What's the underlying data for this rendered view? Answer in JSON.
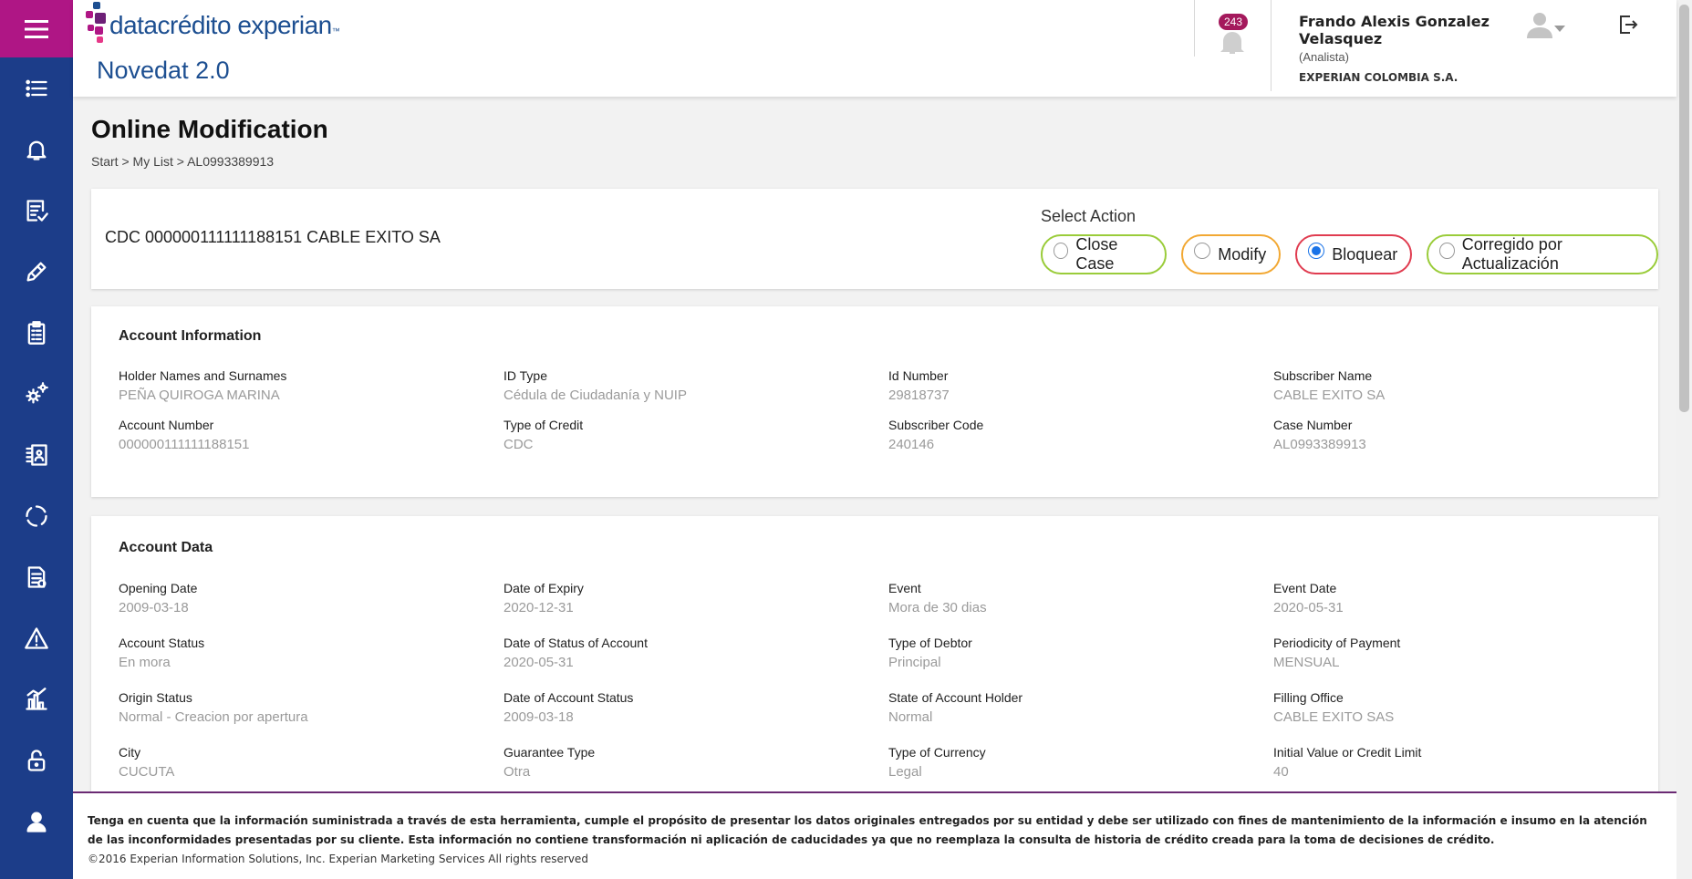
{
  "header": {
    "logo_text_a": "datacrédito",
    "logo_text_b": "experian",
    "logo_tm": "™",
    "app_name": "Novedat 2.0",
    "notification_count": "243",
    "user": {
      "name": "Frando Alexis Gonzalez Velasquez",
      "role": "(Analista)",
      "company": "EXPERIAN COLOMBIA S.A."
    }
  },
  "sidebar": {
    "items": [
      "list-icon",
      "bell-icon",
      "checklist-icon",
      "pencil-icon",
      "clipboard-icon",
      "gears-icon",
      "contacts-icon",
      "refresh-icon",
      "document-icon",
      "warning-icon",
      "chart-icon",
      "unlock-icon",
      "user-icon"
    ]
  },
  "page": {
    "title": "Online Modification",
    "breadcrumb": [
      "Start",
      ">",
      "My List",
      ">",
      "AL0993389913"
    ]
  },
  "case": {
    "id_text": "CDC 000000111111188151 CABLE EXITO SA",
    "select_action_label": "Select Action",
    "actions": [
      {
        "label": "Close Case",
        "selected": false,
        "color": "#9acc3a"
      },
      {
        "label": "Modify",
        "selected": false,
        "color": "#f2a833"
      },
      {
        "label": "Bloquear",
        "selected": true,
        "color": "#e03c50"
      },
      {
        "label": "Corregido por Actualización",
        "selected": false,
        "color": "#9acc3a"
      }
    ]
  },
  "account_information": {
    "title": "Account Information",
    "fields": [
      {
        "label": "Holder Names and Surnames",
        "value": "PEÑA QUIROGA MARINA"
      },
      {
        "label": "ID Type",
        "value": "Cédula de Ciudadanía y NUIP"
      },
      {
        "label": "Id Number",
        "value": "29818737"
      },
      {
        "label": "Subscriber Name",
        "value": "CABLE EXITO SA"
      },
      {
        "label": "Account Number",
        "value": "000000111111188151"
      },
      {
        "label": "Type of Credit",
        "value": "CDC"
      },
      {
        "label": "Subscriber Code",
        "value": "240146"
      },
      {
        "label": "Case Number",
        "value": "AL0993389913"
      }
    ]
  },
  "account_data": {
    "title": "Account Data",
    "fields": [
      {
        "label": "Opening Date",
        "value": "2009-03-18"
      },
      {
        "label": "Date of Expiry",
        "value": "2020-12-31"
      },
      {
        "label": "Event",
        "value": "Mora de 30 dias"
      },
      {
        "label": "Event Date",
        "value": "2020-05-31"
      },
      {
        "label": "Account Status",
        "value": "En mora"
      },
      {
        "label": "Date of Status of Account",
        "value": "2020-05-31"
      },
      {
        "label": "Type of Debtor",
        "value": "Principal"
      },
      {
        "label": "Periodicity of Payment",
        "value": "MENSUAL"
      },
      {
        "label": "Origin Status",
        "value": "Normal - Creacion por apertura"
      },
      {
        "label": "Date of Account Status",
        "value": "2009-03-18"
      },
      {
        "label": "State of Account Holder",
        "value": "Normal"
      },
      {
        "label": "Filling Office",
        "value": "CABLE EXITO SAS"
      },
      {
        "label": "City",
        "value": "CUCUTA"
      },
      {
        "label": "Guarantee Type",
        "value": "Otra"
      },
      {
        "label": "Type of Currency",
        "value": "Legal"
      },
      {
        "label": "Initial Value or Credit Limit",
        "value": "40"
      }
    ]
  },
  "footer": {
    "note": "Tenga en cuenta que la información suministrada a través de esta herramienta, cumple el propósito de presentar los datos originales entregados por su entidad y debe ser utilizado con fines de mantenimiento de la información e insumo en la atención de las inconformidades presentadas por su cliente. Esta información no contiene transformación ni aplicación de caducidades ya que no reemplaza la consulta de historia de crédito creada para la toma de decisiones de crédito.",
    "copyright": "©2016 Experian Information Solutions, Inc. Experian Marketing Services All rights reserved"
  }
}
